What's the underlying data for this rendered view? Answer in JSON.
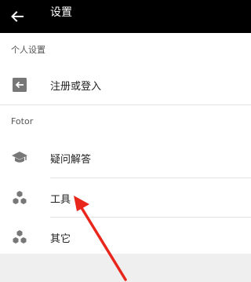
{
  "header": {
    "title": "设置",
    "back_icon": "arrow-left-icon"
  },
  "sections": [
    {
      "title": "个人设置",
      "items": [
        {
          "label": "注册或登入",
          "icon": "login-icon"
        }
      ]
    },
    {
      "title": "Fotor",
      "items": [
        {
          "label": "疑问解答",
          "icon": "graduation-cap-icon"
        },
        {
          "label": "工具",
          "icon": "hexagon-cluster-icon"
        },
        {
          "label": "其它",
          "icon": "hexagon-cluster-icon"
        }
      ]
    }
  ],
  "colors": {
    "topbar": "#000000",
    "icon": "#777777",
    "annotation_arrow": "#e8261c"
  }
}
